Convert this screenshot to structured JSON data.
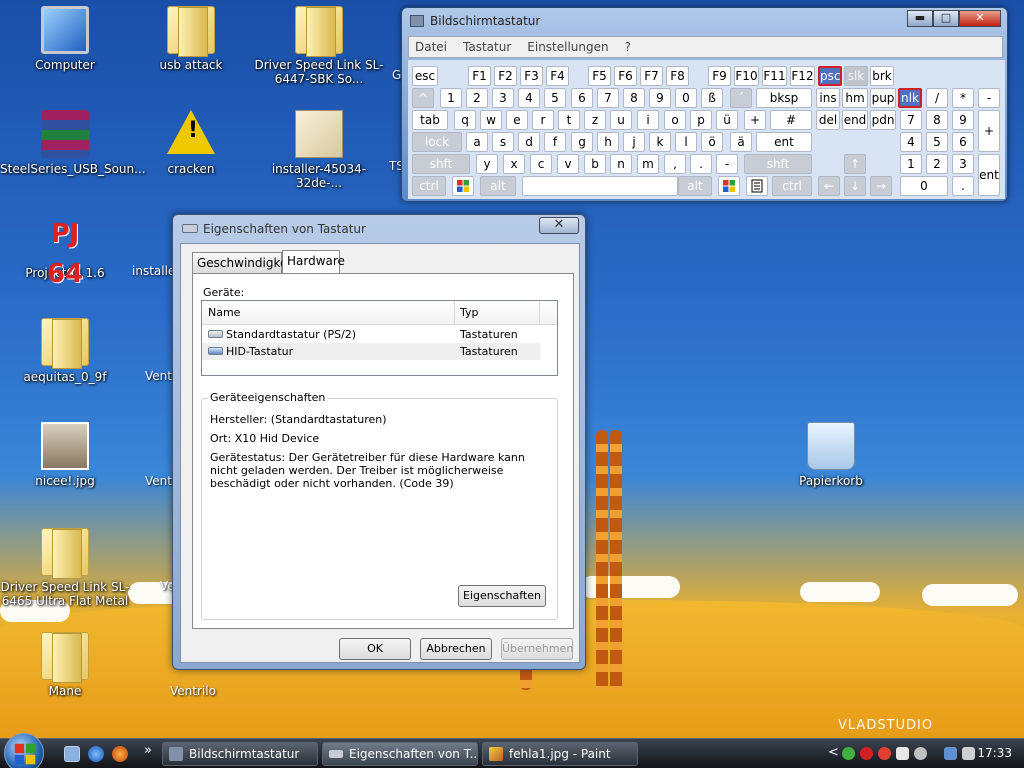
{
  "desktop": {
    "icons": [
      {
        "label": "Computer"
      },
      {
        "label": "usb attack"
      },
      {
        "label": "Driver Speed Link SL-6447-SBK So..."
      },
      {
        "label": "SteelSeries_USB_Soun..."
      },
      {
        "label": "cracken"
      },
      {
        "label": "installer-45034-32de-..."
      },
      {
        "label": "Project64 1.6"
      },
      {
        "label": "installer"
      },
      {
        "label": "aequitas_0_9f"
      },
      {
        "label": "Ventri"
      },
      {
        "label": "nicee!.jpg"
      },
      {
        "label": "Ventri"
      },
      {
        "label": "Driver Speed Link SL-6465 Ultra Flat Metal"
      },
      {
        "label": "Ve"
      },
      {
        "label": "Mane"
      },
      {
        "label": "Ventrilo"
      },
      {
        "label": "Papierkorb"
      }
    ],
    "partial_g": "G",
    "partial_ts": "TS",
    "pj_logo": "PJ 64",
    "watermark": "VLADSTUDIO"
  },
  "osk": {
    "title": "Bildschirmtastatur",
    "menu": [
      "Datei",
      "Tastatur",
      "Einstellungen",
      "?"
    ],
    "window_buttons": {
      "minimize": "▬",
      "maximize": "□",
      "close": "✕"
    },
    "keys": {
      "esc": "esc",
      "f1": "F1",
      "f2": "F2",
      "f3": "F3",
      "f4": "F4",
      "f5": "F5",
      "f6": "F6",
      "f7": "F7",
      "f8": "F8",
      "f9": "F9",
      "f10": "F10",
      "f11": "F11",
      "f12": "F12",
      "psc": "psc",
      "slk": "slk",
      "brk": "brk",
      "caret": "^",
      "n1": "1",
      "n2": "2",
      "n3": "3",
      "n4": "4",
      "n5": "5",
      "n6": "6",
      "n7": "7",
      "n8": "8",
      "n9": "9",
      "n0": "0",
      "sz": "ß",
      "acute": "´",
      "bksp": "bksp",
      "ins": "ins",
      "hm": "hm",
      "pup": "pup",
      "nlk": "nlk",
      "kp_div": "/",
      "kp_mul": "*",
      "kp_sub": "-",
      "tab": "tab",
      "q": "q",
      "w": "w",
      "e": "e",
      "r": "r",
      "t": "t",
      "z": "z",
      "u": "u",
      "i": "i",
      "o": "o",
      "p": "p",
      "ue": "ü",
      "plus": "+",
      "hash": "#",
      "del": "del",
      "end": "end",
      "pdn": "pdn",
      "kp7": "7",
      "kp8": "8",
      "kp9": "9",
      "kp_add": "+",
      "lock": "lock",
      "a": "a",
      "s": "s",
      "d": "d",
      "f": "f",
      "g": "g",
      "h": "h",
      "j": "j",
      "k": "k",
      "l": "l",
      "oe": "ö",
      "ae": "ä",
      "ent": "ent",
      "kp4": "4",
      "kp5": "5",
      "kp6": "6",
      "lshft": "shft",
      "y": "y",
      "x": "x",
      "c": "c",
      "v": "v",
      "b": "b",
      "n": "n",
      "m": "m",
      "comma": ",",
      "period": ".",
      "minus": "-",
      "rshft": "shft",
      "up": "↑",
      "kp1": "1",
      "kp2": "2",
      "kp3": "3",
      "kp_ent": "ent",
      "lctrl": "ctrl",
      "lalt": "alt",
      "altgr": "alt",
      "rctrl": "ctrl",
      "left": "←",
      "down": "↓",
      "right": "→",
      "kp0": "0",
      "kp_dot": "."
    }
  },
  "dialog": {
    "title": "Eigenschaften von Tastatur",
    "close": "✕",
    "tabs": [
      "Geschwindigkeit",
      "Hardware"
    ],
    "devices_label": "Geräte:",
    "columns": {
      "name": "Name",
      "type": "Typ"
    },
    "devices": [
      {
        "name": "Standardtastatur (PS/2)",
        "type": "Tastaturen"
      },
      {
        "name": "HID-Tastatur",
        "type": "Tastaturen"
      }
    ],
    "group_label": "Geräteeigenschaften",
    "manufacturer": "Hersteller: (Standardtastaturen)",
    "location": "Ort: X10 Hid Device",
    "status": "Gerätestatus: Der Gerätetreiber für diese Hardware kann nicht geladen werden. Der Treiber ist möglicherweise beschädigt oder nicht vorhanden. (Code 39)",
    "properties_button": "Eigenschaften",
    "ok": "OK",
    "cancel": "Abbrechen",
    "apply": "Übernehmen"
  },
  "taskbar": {
    "buttons": [
      {
        "label": "Bildschirmtastatur"
      },
      {
        "label": "Eigenschaften von T..."
      },
      {
        "label": "fehla1.jpg - Paint"
      }
    ],
    "overflow": "»",
    "tray_chevron": "<",
    "clock": "17:33"
  }
}
